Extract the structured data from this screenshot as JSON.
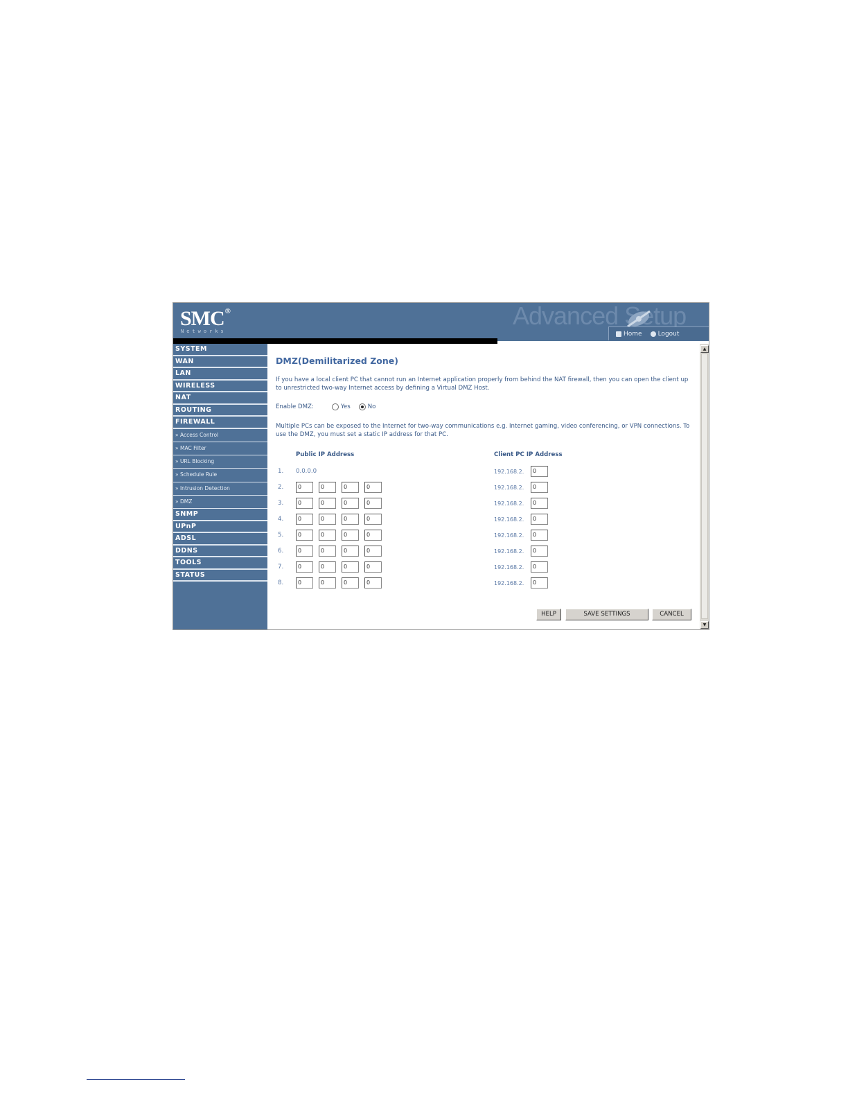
{
  "header": {
    "logo": "SMC",
    "logo_reg": "®",
    "logo_sub": "Networks",
    "banner": "Advanced Setup",
    "home": "Home",
    "logout": "Logout"
  },
  "sidebar": {
    "items": [
      {
        "label": "SYSTEM",
        "type": "nav"
      },
      {
        "label": "WAN",
        "type": "nav"
      },
      {
        "label": "LAN",
        "type": "nav"
      },
      {
        "label": "WIRELESS",
        "type": "nav"
      },
      {
        "label": "NAT",
        "type": "nav"
      },
      {
        "label": "ROUTING",
        "type": "nav"
      },
      {
        "label": "FIREWALL",
        "type": "nav"
      },
      {
        "label": "» Access Control",
        "type": "sub"
      },
      {
        "label": "» MAC Filter",
        "type": "sub"
      },
      {
        "label": "» URL Blocking",
        "type": "sub"
      },
      {
        "label": "» Schedule Rule",
        "type": "sub"
      },
      {
        "label": "» Intrusion Detection",
        "type": "sub"
      },
      {
        "label": "» DMZ",
        "type": "sub"
      },
      {
        "label": "SNMP",
        "type": "nav"
      },
      {
        "label": "UPnP",
        "type": "nav"
      },
      {
        "label": "ADSL",
        "type": "nav"
      },
      {
        "label": "DDNS",
        "type": "nav"
      },
      {
        "label": "TOOLS",
        "type": "nav"
      },
      {
        "label": "STATUS",
        "type": "nav"
      }
    ]
  },
  "main": {
    "title": "DMZ(Demilitarized Zone)",
    "intro": "If you have a local client PC that cannot run an Internet application properly from behind the NAT firewall, then you can open the client up to unrestricted two-way Internet access by defining a Virtual DMZ Host.",
    "enable_label": "Enable DMZ:",
    "yes_label": "Yes",
    "no_label": "No",
    "enabled": false,
    "info": "Multiple PCs can be exposed to the Internet for two-way communications e.g. Internet gaming, video conferencing, or VPN connections.  To use the DMZ, you must set a static IP address for that PC.",
    "col_public": "Public IP Address",
    "col_client": "Client PC IP Address",
    "rows": [
      {
        "num": "1.",
        "public_fixed": "0.0.0.0",
        "public": null,
        "client_prefix": "192.168.2.",
        "client": "0"
      },
      {
        "num": "2.",
        "public_fixed": null,
        "public": [
          "0",
          "0",
          "0",
          "0"
        ],
        "client_prefix": "192.168.2.",
        "client": "0"
      },
      {
        "num": "3.",
        "public_fixed": null,
        "public": [
          "0",
          "0",
          "0",
          "0"
        ],
        "client_prefix": "192.168.2.",
        "client": "0"
      },
      {
        "num": "4.",
        "public_fixed": null,
        "public": [
          "0",
          "0",
          "0",
          "0"
        ],
        "client_prefix": "192.168.2.",
        "client": "0"
      },
      {
        "num": "5.",
        "public_fixed": null,
        "public": [
          "0",
          "0",
          "0",
          "0"
        ],
        "client_prefix": "192.168.2.",
        "client": "0"
      },
      {
        "num": "6.",
        "public_fixed": null,
        "public": [
          "0",
          "0",
          "0",
          "0"
        ],
        "client_prefix": "192.168.2.",
        "client": "0"
      },
      {
        "num": "7.",
        "public_fixed": null,
        "public": [
          "0",
          "0",
          "0",
          "0"
        ],
        "client_prefix": "192.168.2.",
        "client": "0"
      },
      {
        "num": "8.",
        "public_fixed": null,
        "public": [
          "0",
          "0",
          "0",
          "0"
        ],
        "client_prefix": "192.168.2.",
        "client": "0"
      }
    ],
    "help_label": "HELP",
    "save_label": "SAVE SETTINGS",
    "cancel_label": "CANCEL"
  },
  "scroll": {
    "up": "▲",
    "down": "▼"
  }
}
